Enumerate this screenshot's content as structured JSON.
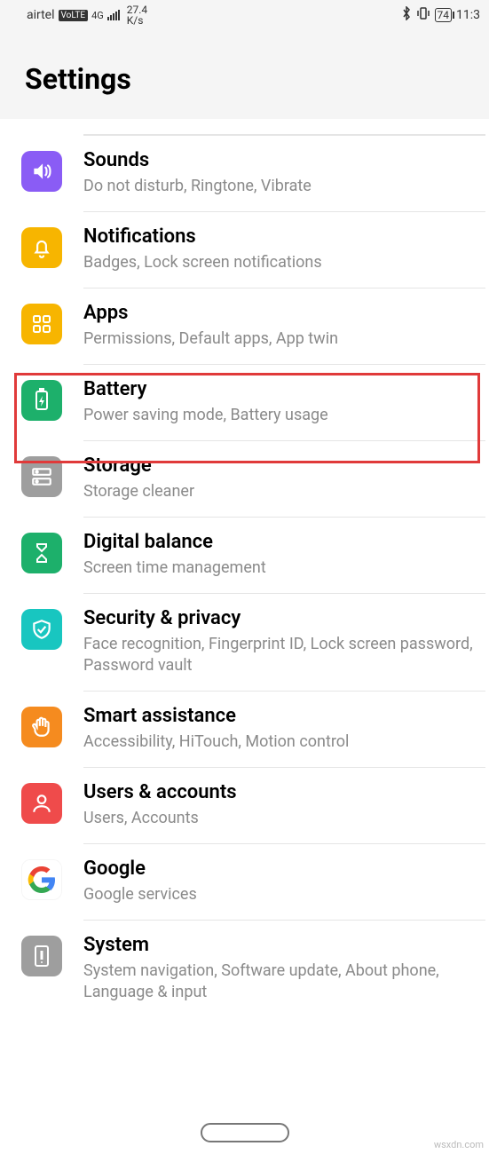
{
  "status": {
    "carrier": "airtel",
    "volte": "VoLTE",
    "net_top": "4G",
    "net_bottom": "1↓↑",
    "speed_top": "27.4",
    "speed_bottom": "K/s",
    "battery": "74",
    "time": "11:3"
  },
  "header": {
    "title": "Settings"
  },
  "items": [
    {
      "title": "Sounds",
      "subtitle": "Do not disturb, Ringtone, Vibrate",
      "icon": "sounds",
      "bg": "#8a5cf5"
    },
    {
      "title": "Notifications",
      "subtitle": "Badges, Lock screen notifications",
      "icon": "bell",
      "bg": "#f7b500"
    },
    {
      "title": "Apps",
      "subtitle": "Permissions, Default apps, App twin",
      "icon": "apps",
      "bg": "#f7b500"
    },
    {
      "title": "Battery",
      "subtitle": "Power saving mode, Battery usage",
      "icon": "battery",
      "bg": "#1db06b"
    },
    {
      "title": "Storage",
      "subtitle": "Storage cleaner",
      "icon": "storage",
      "bg": "#9e9e9e"
    },
    {
      "title": "Digital balance",
      "subtitle": "Screen time management",
      "icon": "hourglass",
      "bg": "#1db06b"
    },
    {
      "title": "Security & privacy",
      "subtitle": "Face recognition, Fingerprint ID, Lock screen password, Password vault",
      "icon": "shield",
      "bg": "#18c6c0"
    },
    {
      "title": "Smart assistance",
      "subtitle": "Accessibility, HiTouch, Motion control",
      "icon": "hand",
      "bg": "#f58b1f"
    },
    {
      "title": "Users & accounts",
      "subtitle": "Users, Accounts",
      "icon": "user",
      "bg": "#ef4b4b"
    },
    {
      "title": "Google",
      "subtitle": "Google services",
      "icon": "google",
      "bg": "#ffffff"
    },
    {
      "title": "System",
      "subtitle": "System navigation, Software update, About phone, Language & input",
      "icon": "system",
      "bg": "#9e9e9e"
    }
  ],
  "watermark": "wsxdn.com"
}
